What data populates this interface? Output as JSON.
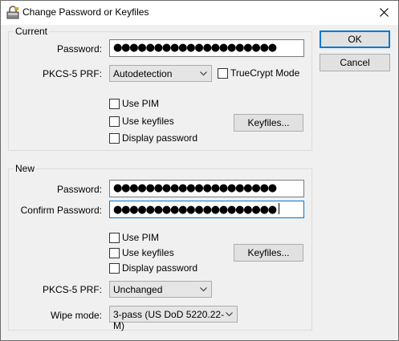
{
  "window": {
    "title": "Change Password or Keyfiles",
    "icon": "truecrypt-app-icon",
    "close_icon": "close-icon"
  },
  "buttons": {
    "ok": "OK",
    "cancel": "Cancel"
  },
  "current": {
    "legend": "Current",
    "password_label": "Password:",
    "password_mask": "●●●●●●●●●●●●●●●●●●●●",
    "prf_label": "PKCS-5 PRF:",
    "prf_value": "Autodetection",
    "truecrypt_mode": "TrueCrypt Mode",
    "use_pim": "Use PIM",
    "use_keyfiles": "Use keyfiles",
    "display_password": "Display password",
    "keyfiles_button": "Keyfiles..."
  },
  "new": {
    "legend": "New",
    "password_label": "Password:",
    "password_mask": "●●●●●●●●●●●●●●●●●●●●",
    "confirm_label": "Confirm Password:",
    "confirm_mask": "●●●●●●●●●●●●●●●●●●●●",
    "use_pim": "Use PIM",
    "use_keyfiles": "Use keyfiles",
    "display_password": "Display password",
    "keyfiles_button": "Keyfiles...",
    "prf_label": "PKCS-5 PRF:",
    "prf_value": "Unchanged",
    "wipe_label": "Wipe mode:",
    "wipe_value": "3-pass (US DoD 5220.22-M)"
  },
  "colors": {
    "focus_border": "#0078d7",
    "dialog_bg": "#f0f0f0"
  }
}
